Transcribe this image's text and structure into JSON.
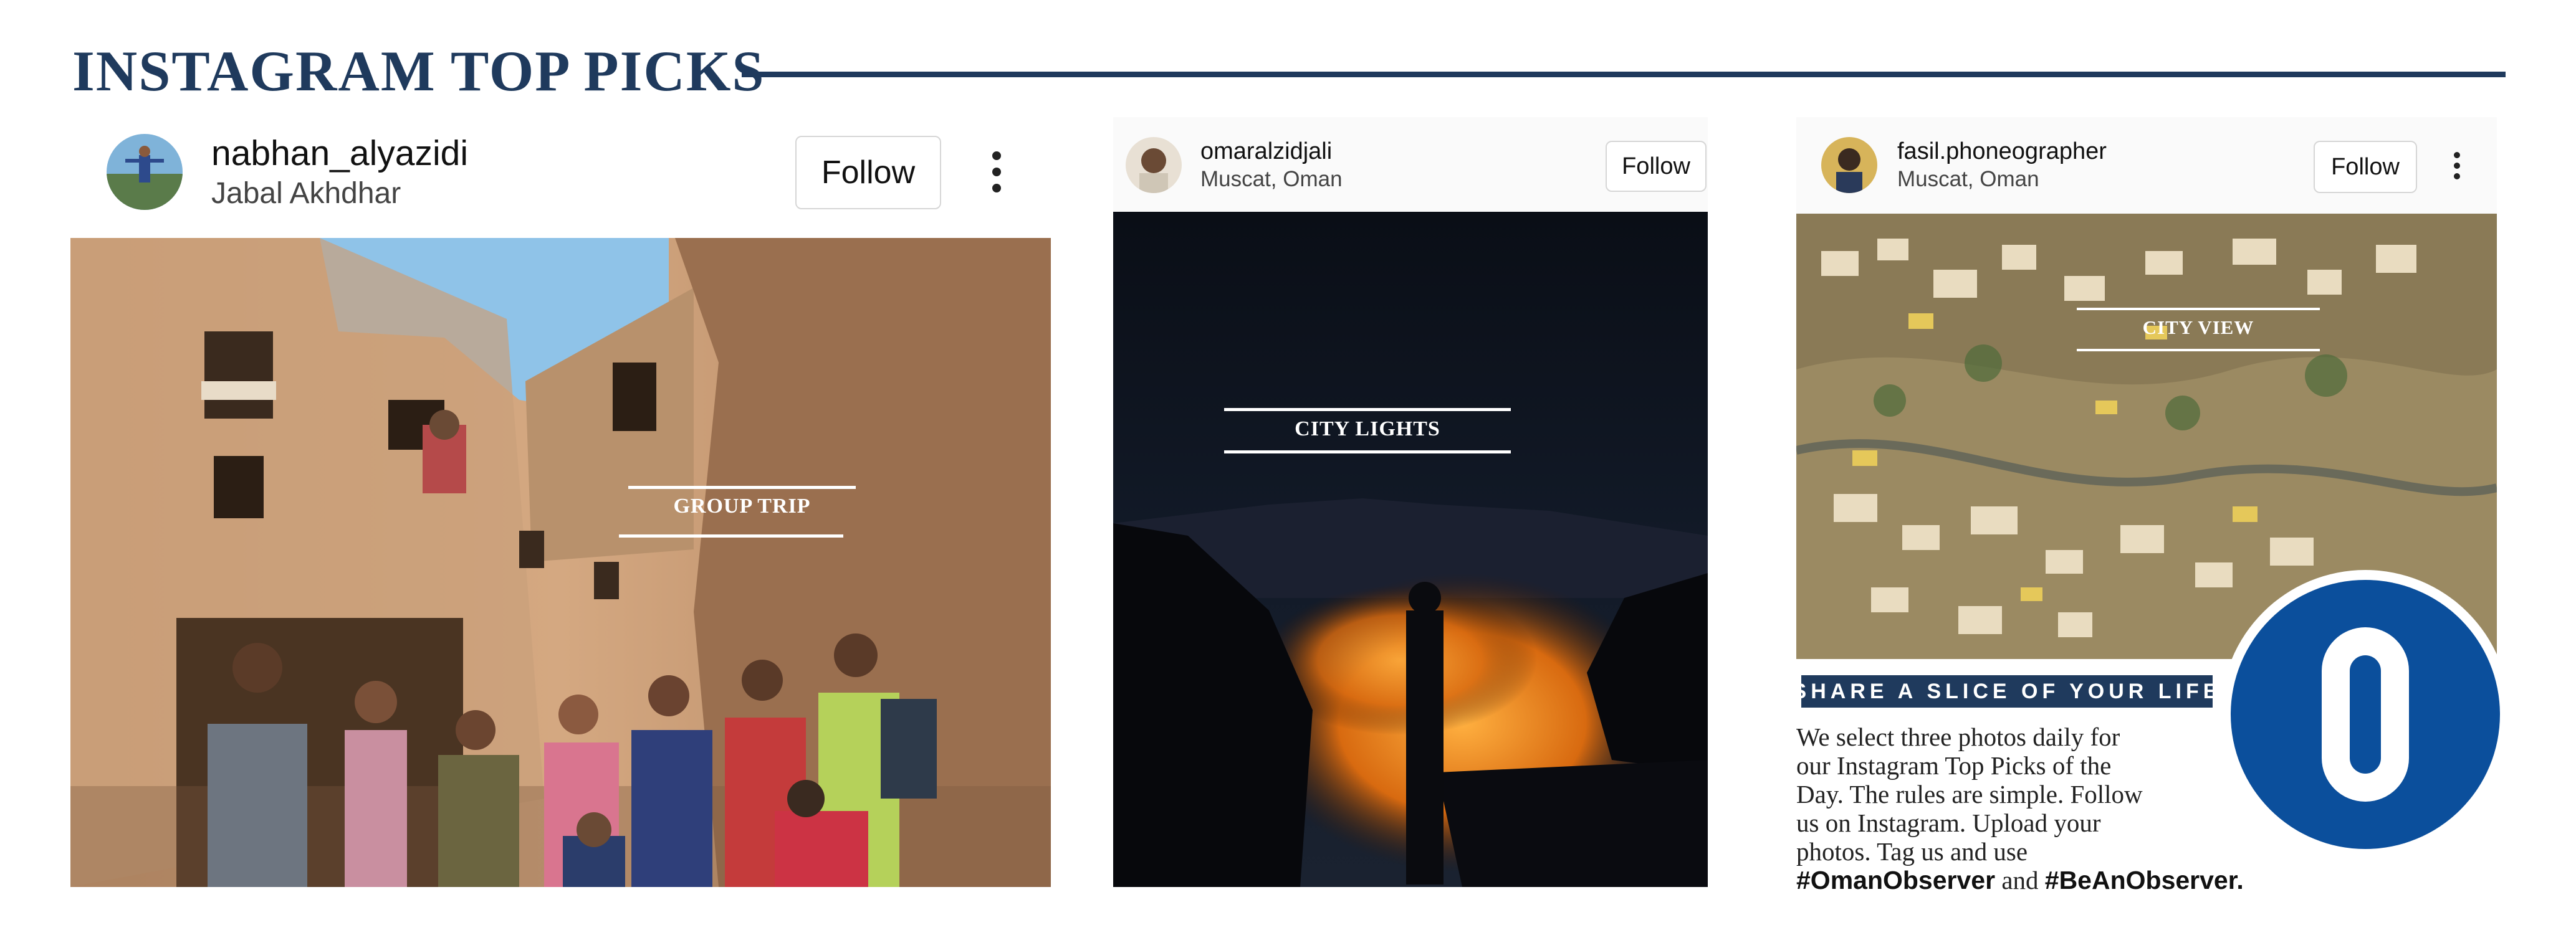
{
  "header": {
    "title": "INSTAGRAM TOP PICKS"
  },
  "posts": [
    {
      "username": "nabhan_alyazidi",
      "location": "Jabal Akhdhar",
      "follow_label": "Follow",
      "photo_tag": "GROUP TRIP"
    },
    {
      "username": "omaralzidjali",
      "location": "Muscat, Oman",
      "follow_label": "Follow",
      "photo_tag": "CITY LIGHTS"
    },
    {
      "username": "fasil.phoneographer",
      "location": "Muscat, Oman",
      "follow_label": "Follow",
      "photo_tag": "CITY VIEW"
    }
  ],
  "info": {
    "banner": "SHARE A SLICE OF YOUR LIFE",
    "lines": [
      "We select three photos daily for",
      "our Instagram Top Picks of the",
      "Day. The rules are simple. Follow",
      "us on Instagram. Upload your",
      "photos. Tag us and use"
    ],
    "hashtag_1": "#OmanObserver",
    "connector": "and",
    "hashtag_2": "#BeAnObserver."
  },
  "logo": {
    "letter": "O"
  },
  "colors": {
    "navy": "#1f3a5d",
    "logo_blue": "#0b4f9c"
  }
}
